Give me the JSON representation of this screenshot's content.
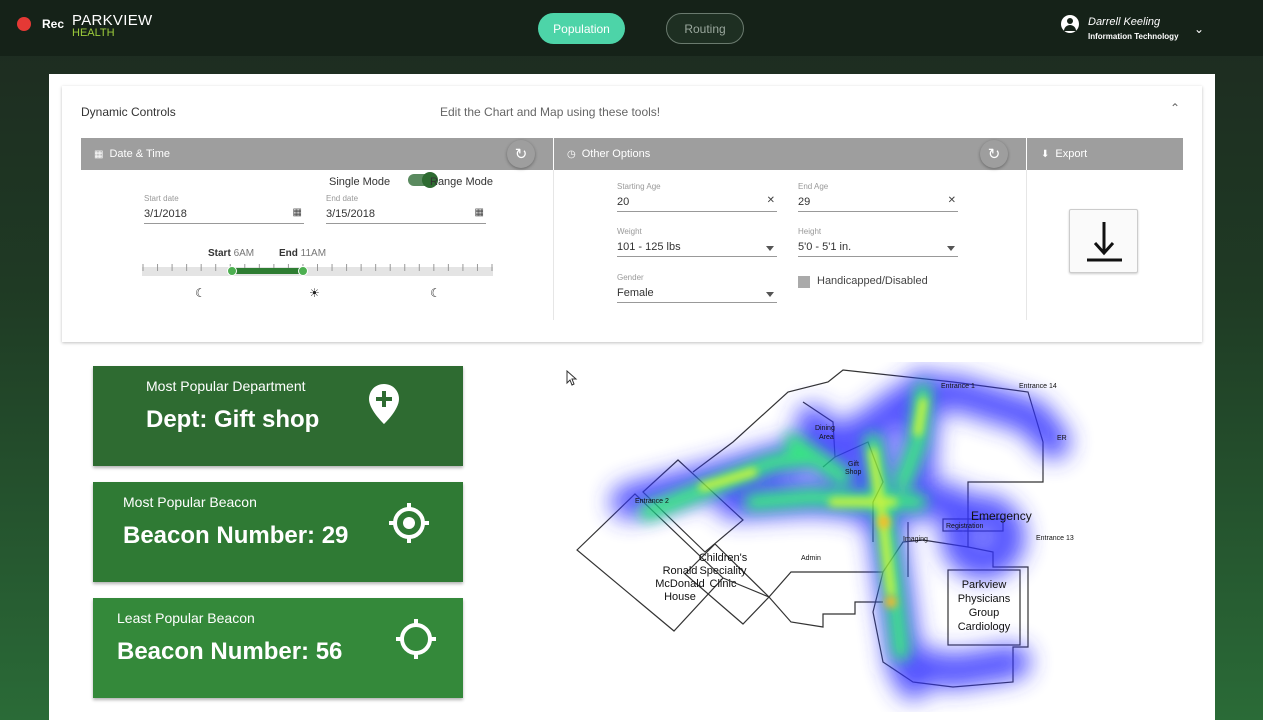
{
  "recorder": {
    "label": "Rec"
  },
  "brand": {
    "line1": "PARKVIEW",
    "line2": "HEALTH"
  },
  "nav": {
    "population": "Population",
    "routing": "Routing"
  },
  "user": {
    "name": "Darrell Keeling",
    "department": "Information Technology"
  },
  "dynamic_controls": {
    "title": "Dynamic Controls",
    "subtitle": "Edit the Chart and Map using these tools!"
  },
  "date_time": {
    "header": "Date & Time",
    "single_mode": "Single Mode",
    "range_mode": "Range Mode",
    "mode_value": "Range Mode",
    "start_label": "Start date",
    "start_value": "3/1/2018",
    "end_label": "End date",
    "end_value": "3/15/2018",
    "slider_start_label": "Start",
    "slider_start_value": "6AM",
    "slider_end_label": "End",
    "slider_end_value": "11AM"
  },
  "other_options": {
    "header": "Other Options",
    "starting_age_label": "Starting Age",
    "starting_age_value": "20",
    "end_age_label": "End Age",
    "end_age_value": "29",
    "weight_label": "Weight",
    "weight_value": "101 - 125 lbs",
    "height_label": "Height",
    "height_value": "5'0 - 5'1 in.",
    "gender_label": "Gender",
    "gender_value": "Female",
    "handicapped_label": "Handicapped/Disabled"
  },
  "export": {
    "header": "Export"
  },
  "stats": {
    "dept_title": "Most Popular Department",
    "dept_value": "Dept: Gift shop",
    "most_beacon_title": "Most Popular Beacon",
    "most_beacon_value": "Beacon Number: 29",
    "least_beacon_title": "Least Popular Beacon",
    "least_beacon_value": "Beacon Number: 56"
  },
  "map": {
    "labels": {
      "entrance_1": "Entrance 1",
      "entrance_14": "Entrance 14",
      "er": "ER",
      "registration": "Registration",
      "dining_area_1": "Dining",
      "dining_area_2": "Area",
      "gift_1": "Gift",
      "gift_2": "Shop",
      "entrance_2": "Entrance 2",
      "emergency": "Emergency",
      "entrance_13": "Entrance 13",
      "imaging": "Imaging",
      "admin": "Admin",
      "ronald_1": "Ronald",
      "ronald_2": "McDonald",
      "ronald_3": "House",
      "childrens_1": "Children's",
      "childrens_2": "Speciality",
      "childrens_3": "Clinic",
      "ppg_1": "Parkview",
      "ppg_2": "Physicians",
      "ppg_3": "Group",
      "ppg_4": "Cardiology"
    }
  }
}
